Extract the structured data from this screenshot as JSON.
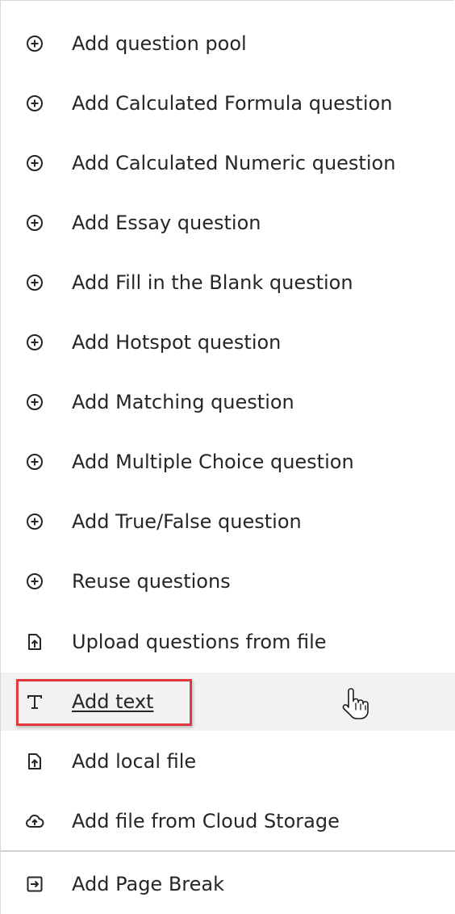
{
  "menu": {
    "items": [
      {
        "label": "Add question pool",
        "icon": "plus-circle-icon"
      },
      {
        "label": "Add Calculated Formula question",
        "icon": "plus-circle-icon"
      },
      {
        "label": "Add Calculated Numeric question",
        "icon": "plus-circle-icon"
      },
      {
        "label": "Add Essay question",
        "icon": "plus-circle-icon"
      },
      {
        "label": "Add Fill in the Blank question",
        "icon": "plus-circle-icon"
      },
      {
        "label": "Add Hotspot question",
        "icon": "plus-circle-icon"
      },
      {
        "label": "Add Matching question",
        "icon": "plus-circle-icon"
      },
      {
        "label": "Add Multiple Choice question",
        "icon": "plus-circle-icon"
      },
      {
        "label": "Add True/False question",
        "icon": "plus-circle-icon"
      },
      {
        "label": "Reuse questions",
        "icon": "plus-circle-icon"
      },
      {
        "label": "Upload questions from file",
        "icon": "upload-file-icon"
      },
      {
        "label": "Add text",
        "icon": "text-icon",
        "hovered": true,
        "highlighted": true
      },
      {
        "label": "Add local file",
        "icon": "upload-file-icon"
      },
      {
        "label": "Add file from Cloud Storage",
        "icon": "cloud-upload-icon"
      },
      {
        "label": "Add Page Break",
        "icon": "page-break-icon"
      }
    ]
  },
  "colors": {
    "highlight_border": "#e03a3e",
    "hover_background": "#f2f2f2",
    "text": "#262626"
  }
}
